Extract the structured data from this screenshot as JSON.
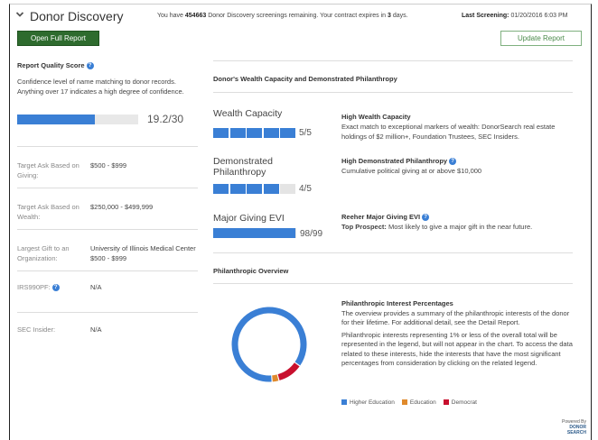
{
  "header": {
    "title": "Donor Discovery",
    "notice_prefix": "You have ",
    "screenings_count": "454663",
    "notice_middle": " Donor Discovery screenings remaining. Your contract expires in ",
    "expires_days": "3",
    "notice_suffix": " days.",
    "last_screening_label": "Last Screening:",
    "last_screening_value": " 01/20/2016 6:03 PM"
  },
  "actions": {
    "open_full_report": "Open Full Report",
    "update_report": "Update Report"
  },
  "report_quality": {
    "title": "Report Quality Score",
    "description": "Confidence level of name matching to donor records. Anything over 17 indicates a high degree of confidence.",
    "score_text": "19.2/30",
    "score_fraction": 0.64
  },
  "left_fields": [
    {
      "label": "Target Ask Based on Giving:",
      "value": "$500 - $999"
    },
    {
      "label": "Target Ask Based on Wealth:",
      "value": "$250,000 - $499,999"
    },
    {
      "label": "Largest Gift to an Organization:",
      "value": "University of Illinois Medical Center $500 - $999"
    },
    {
      "label": "IRS990PF:",
      "value": "N/A"
    },
    {
      "label": "SEC Insider:",
      "value": "N/A"
    }
  ],
  "wealth_section": {
    "title": "Donor's Wealth Capacity and Demonstrated Philanthropy",
    "metrics": [
      {
        "name": "Wealth Capacity",
        "score": "5/5",
        "filled": 5,
        "total": 5,
        "desc_title": "High Wealth Capacity",
        "desc_text": "Exact match to exceptional markers of wealth: DonorSearch real estate holdings of $2 million+, Foundation Trustees, SEC Insiders."
      },
      {
        "name": "Demonstrated Philanthropy",
        "score": "4/5",
        "filled": 4,
        "total": 5,
        "desc_title": "High Demonstrated Philanthropy",
        "desc_text": "Cumulative political giving at or above $10,000"
      },
      {
        "name": "Major Giving EVI",
        "score": "98/99",
        "fraction": 0.99,
        "desc_title": "Reeher Major Giving EVI",
        "desc_bold": "Top Prospect:",
        "desc_text": " Most likely to give a major gift in the near future."
      }
    ]
  },
  "overview": {
    "title": "Philanthropic Overview",
    "interest_title": "Philanthropic Interest Percentages",
    "para1": "The overview provides a summary of the philanthropic interests of the donor for their lifetime. For additional detail, see the Detail Report.",
    "para2": "Philanthropic interests representing 1% or less of the overall total will be represented in the legend, but will not appear in the chart. To access the data related to these interests, hide the interests that have the most significant percentages from consideration by clicking on the related legend.",
    "legend": [
      {
        "name": "Higher Education",
        "color": "#3a7fd5"
      },
      {
        "name": "Education",
        "color": "#e08a2c"
      },
      {
        "name": "Democrat",
        "color": "#c8102e"
      }
    ],
    "chart_data": {
      "type": "pie",
      "categories": [
        "Higher Education",
        "Education",
        "Democrat"
      ],
      "values": [
        86,
        3,
        11
      ]
    }
  },
  "footer": {
    "powered_by": "Powered By",
    "brand_line1": "DONOR",
    "brand_line2": "SEARCH"
  }
}
